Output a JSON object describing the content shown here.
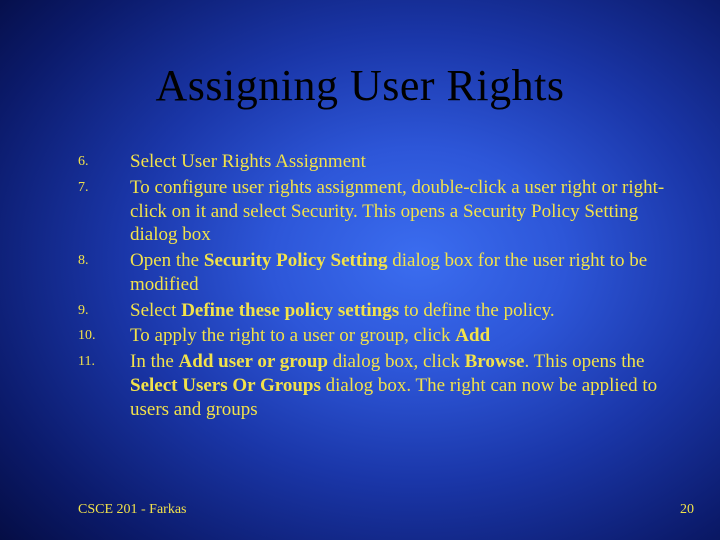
{
  "title": "Assigning User Rights",
  "list": [
    {
      "num": "6.",
      "html": "Select User Rights Assignment"
    },
    {
      "num": "7.",
      "html": "To configure user rights assignment, double-click a user right or right-click on it and select Security. This opens a Security Policy Setting dialog box"
    },
    {
      "num": "8.",
      "html": "Open the <b>Security Policy Setting</b> dialog box for the user right to be modified"
    },
    {
      "num": "9.",
      "html": "Select <b>Define these policy settings</b> to define the policy."
    },
    {
      "num": "10.",
      "html": "To apply the right to a user or group, click <b>Add</b>"
    },
    {
      "num": "11.",
      "html": "In the <b>Add user or group</b> dialog box, click <b>Browse</b>. This opens the <b>Select Users Or Groups</b> dialog box. The right can now be applied to users and groups"
    }
  ],
  "footer": {
    "left": "CSCE 201 - Farkas",
    "right": "20"
  }
}
